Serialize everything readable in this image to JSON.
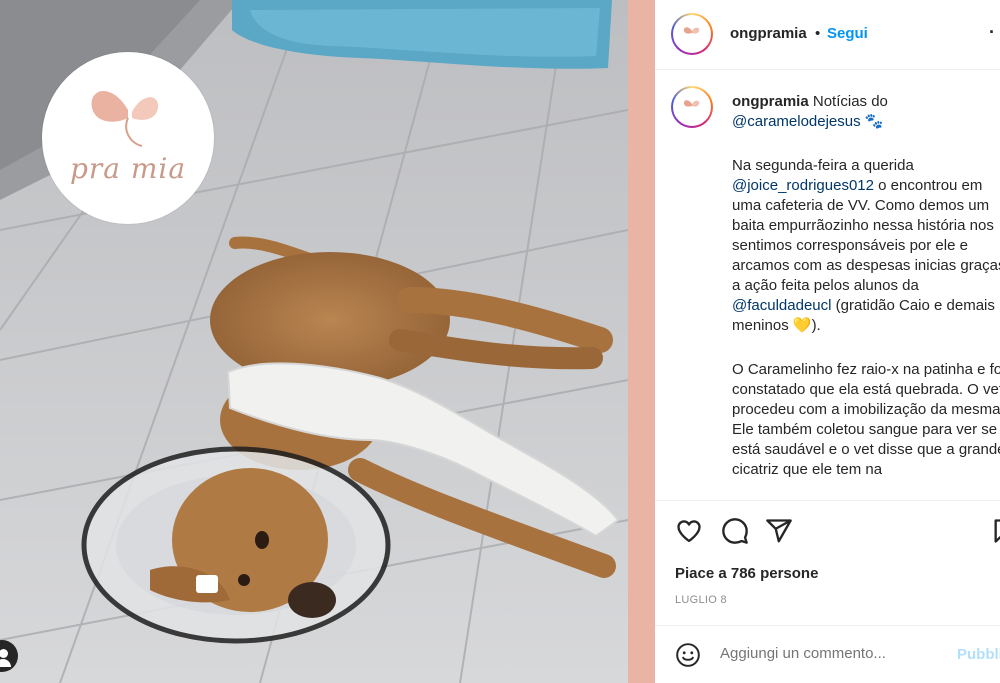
{
  "photo": {
    "logo_text": "pra mia",
    "logo_icon": "butterfly-icon",
    "user_tag_icon": "user-tag-icon"
  },
  "post": {
    "username": "ongpramia",
    "separator": "•",
    "follow_label": "Segui",
    "more_icon": "more-icon",
    "caption": {
      "lead": "Notícias do",
      "mention_1": "@caramelodejesus",
      "paw": "🐾",
      "p1_a": "Na segunda-feira a querida",
      "mention_2": "@joice_rodrigues012",
      "p1_b": "o encontrou em uma cafeteria de VV. Como demos um baita empurrãozinho nessa história nos sentimos corresponsáveis por ele e arcamos com as despesas inicias graças a ação feita pelos alunos da",
      "mention_3": "@faculdadeucl",
      "p1_c": "(gratidão Caio e demais meninos",
      "heart": "💛",
      "p1_d": ").",
      "p2": "O Caramelinho fez raio-x na patinha e foi constatado que ela está quebrada. O vet procedeu com a imobilização da mesma. Ele também coletou sangue para ver se está saudável e o vet disse que a grande cicatriz que ele tem na"
    },
    "actions": {
      "like_icon": "heart-icon",
      "comment_icon": "comment-icon",
      "share_icon": "share-icon",
      "save_icon": "bookmark-icon"
    },
    "likes_text": "Piace a 786 persone",
    "date": "LUGLIO 8",
    "comment": {
      "placeholder": "Aggiungi un commento...",
      "post_label": "Pubblica",
      "emoji_icon": "emoji-icon"
    }
  },
  "colors": {
    "accent_bg": "#e9b4a3",
    "link": "#0095f6",
    "mention": "#00376b"
  }
}
